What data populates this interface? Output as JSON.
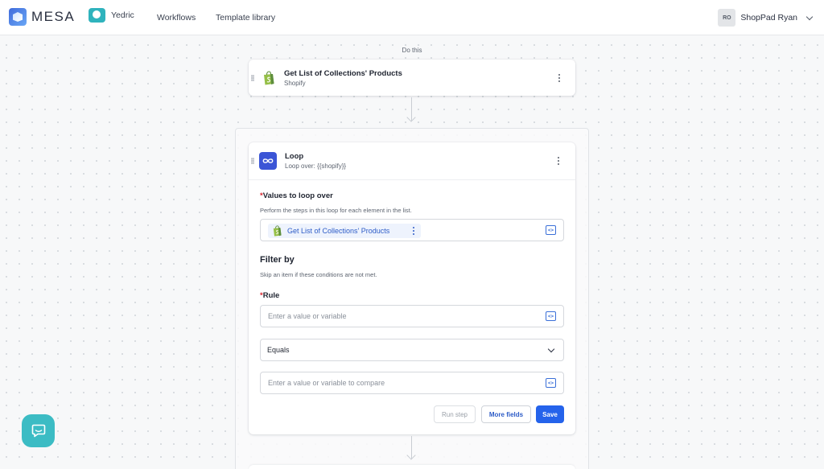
{
  "brand": {
    "name": "MESA"
  },
  "workspace": {
    "name": "Yedric"
  },
  "nav": {
    "workflows": "Workflows",
    "template_library": "Template library"
  },
  "user": {
    "initials": "RO",
    "name": "ShopPad Ryan"
  },
  "flow": {
    "section_label": "Do this",
    "step1": {
      "title": "Get List of Collections' Products",
      "subtitle": "Shopify"
    },
    "loop": {
      "title": "Loop",
      "subtitle": "Loop over: {{shopify}}",
      "values_label": "Values to loop over",
      "values_help": "Perform the steps in this loop for each element in the list.",
      "values_chip": "Get List of Collections' Products",
      "filter_title": "Filter by",
      "filter_help": "Skip an item if these conditions are not met.",
      "rule_label": "Rule",
      "rule_placeholder": "Enter a value or variable",
      "operator_value": "Equals",
      "compare_placeholder": "Enter a value or variable to compare",
      "buttons": {
        "run_step": "Run step",
        "more_fields": "More fields",
        "save": "Save"
      }
    }
  },
  "colors": {
    "accent": "#2563eb",
    "loop_icon": "#3b55d6",
    "shopify": "#95bf47",
    "help_bubble": "#3cbcc4"
  }
}
